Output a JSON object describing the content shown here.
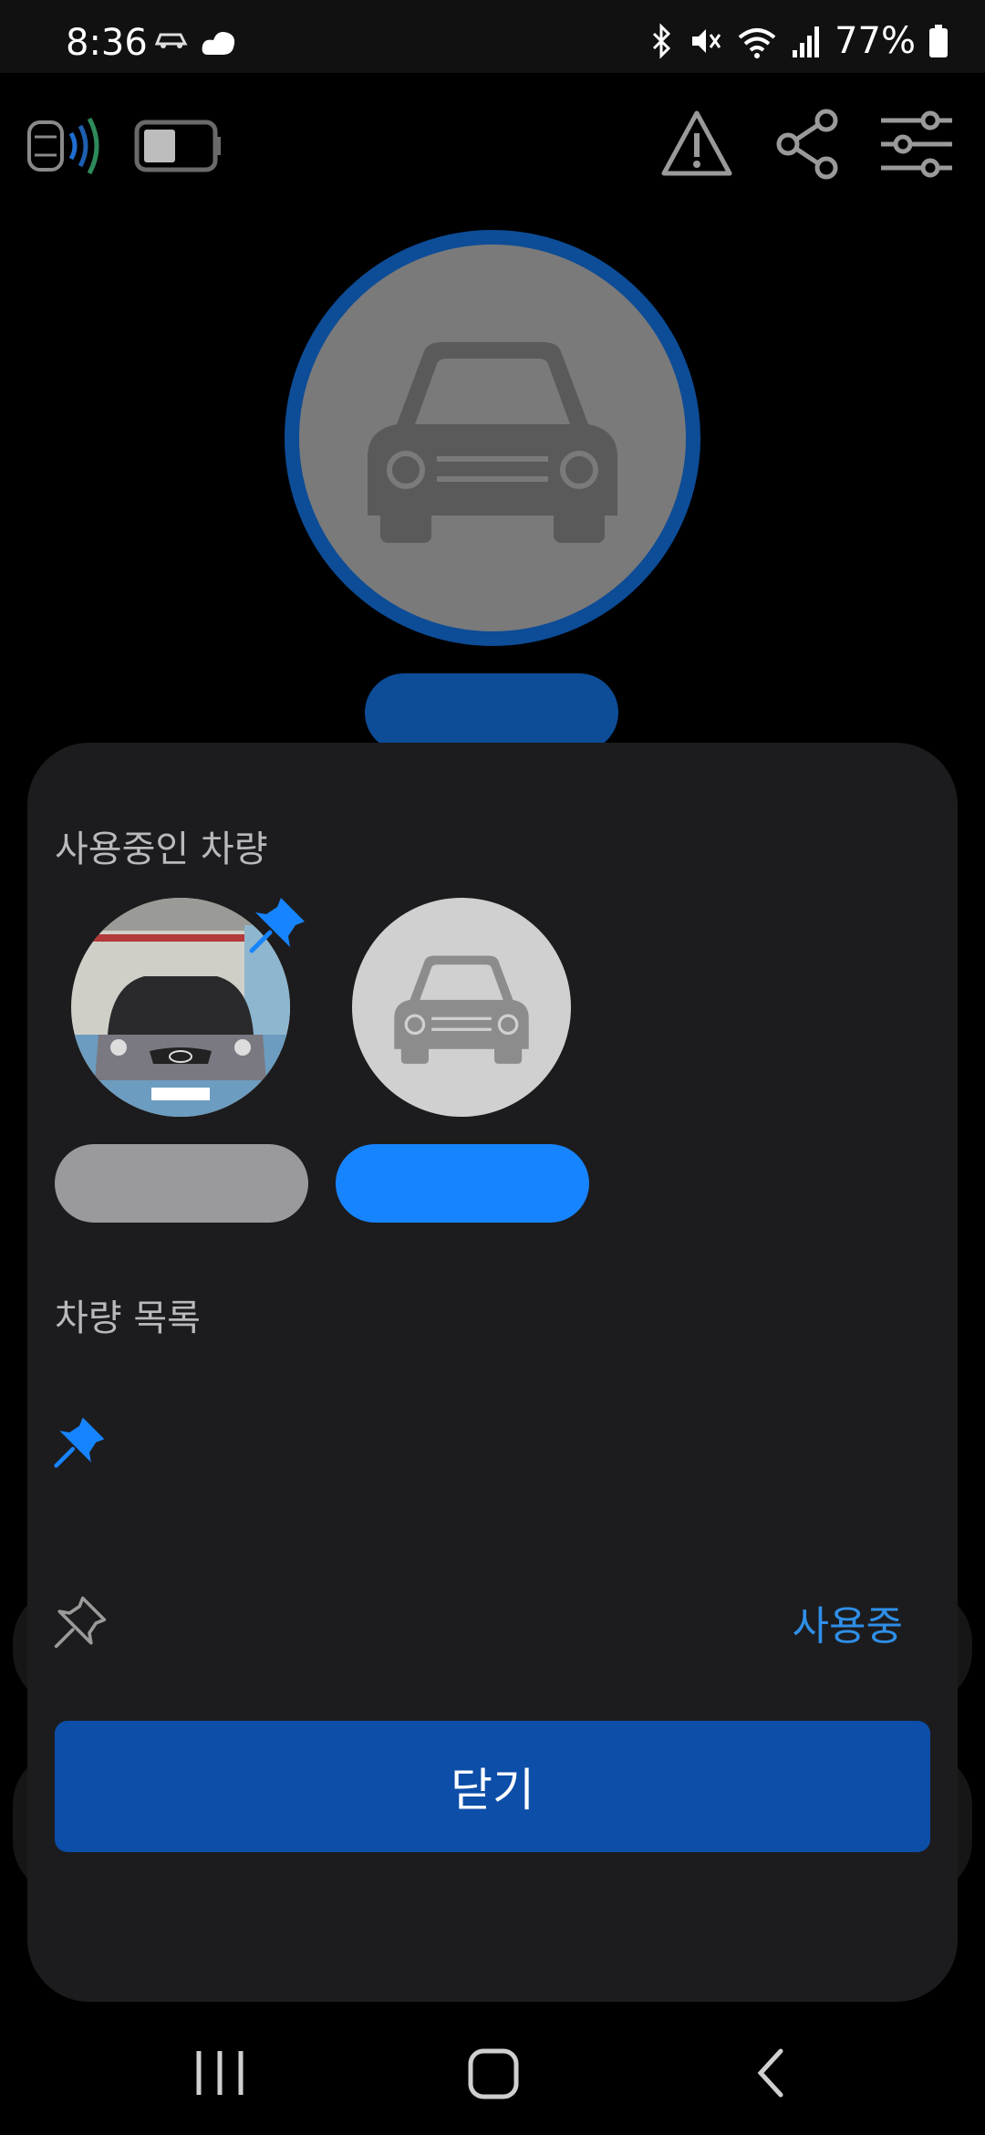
{
  "status_bar": {
    "time": "8:36",
    "battery": "77%",
    "left_icons": [
      "car-notification-icon",
      "weather-icon"
    ],
    "right_icons": [
      "bluetooth-icon",
      "mute-icon",
      "wifi-icon",
      "signal-icon",
      "battery-icon"
    ]
  },
  "top_bar": {
    "left_icons": [
      "car-signal-icon",
      "battery-level-icon"
    ],
    "right_icons": [
      "warning-icon",
      "share-icon",
      "settings-sliders-icon"
    ]
  },
  "sheet": {
    "active_section_title": "사용중인 차량",
    "list_section_title": "차량 목록",
    "list_rows": [
      {
        "pin_state": "pinned",
        "status": ""
      },
      {
        "pin_state": "unpinned",
        "status": "사용중"
      }
    ],
    "close_label": "닫기"
  },
  "colors": {
    "accent": "#1784ff",
    "accent_dark": "#0d4c97",
    "sheet_bg": "#1c1c1e",
    "button": "#0d4ea8",
    "pill_gray": "#9a9a9e"
  },
  "nav_bar": {
    "icons": [
      "recent-apps-icon",
      "home-icon",
      "back-icon"
    ]
  }
}
